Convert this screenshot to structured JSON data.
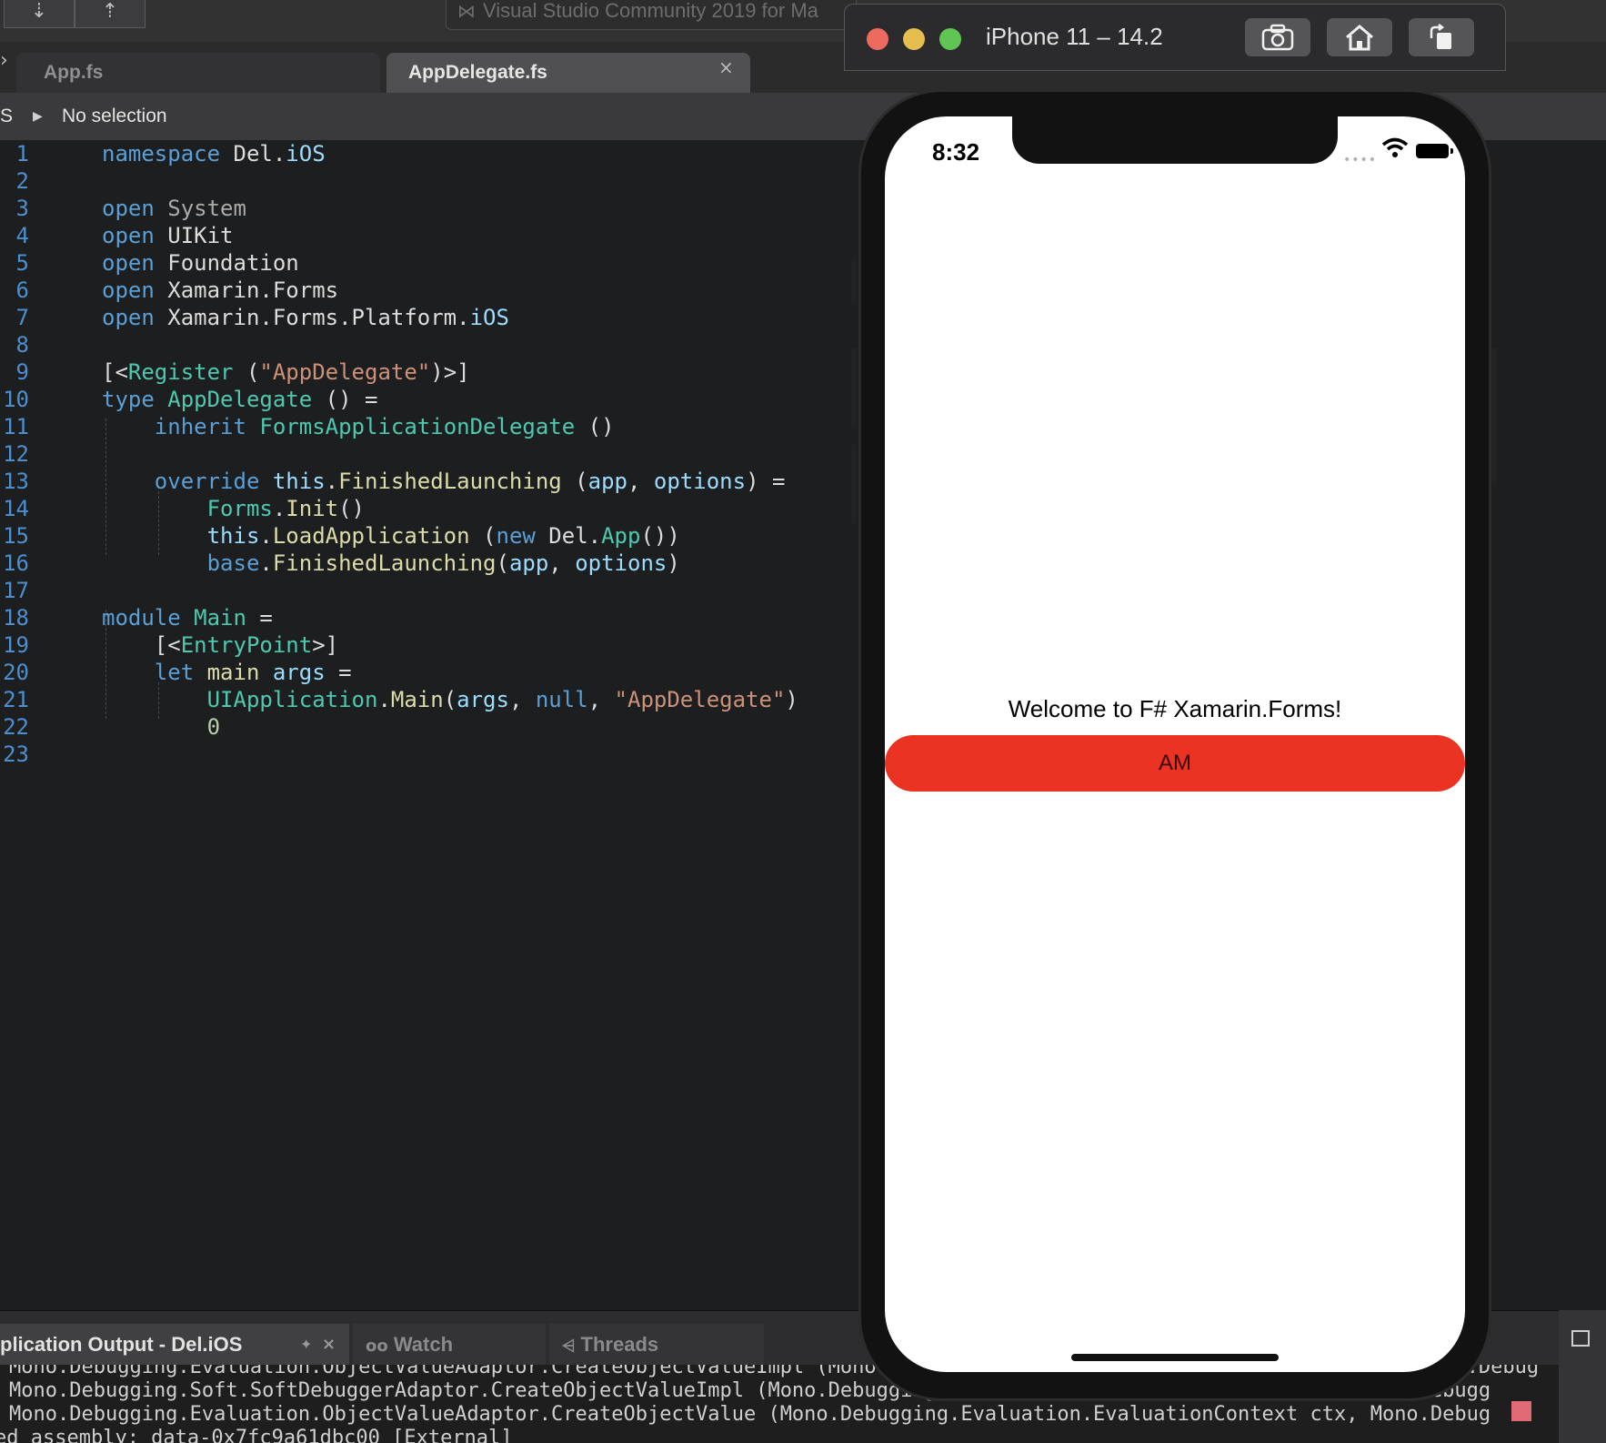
{
  "toolbar": {
    "app_title": "Visual Studio Community 2019 for Ma",
    "step_into_icon": "⇣",
    "step_out_icon": "⇡"
  },
  "tabs": [
    {
      "label": "App.fs",
      "active": false
    },
    {
      "label": "AppDelegate.fs",
      "active": true
    }
  ],
  "tab_close": "×",
  "breadcrumb": {
    "prefix": "S",
    "arrow": "▶",
    "text": "No selection"
  },
  "editor": {
    "line_numbers": [
      "1",
      "2",
      "3",
      "4",
      "5",
      "6",
      "7",
      "8",
      "9",
      "10",
      "11",
      "12",
      "13",
      "14",
      "15",
      "16",
      "17",
      "18",
      "19",
      "20",
      "21",
      "22",
      "23"
    ]
  },
  "simulator": {
    "title": "iPhone 11 – 14.2",
    "screenshot_icon": "camera-icon",
    "home_icon": "home-icon",
    "rotate_icon": "rotate-icon",
    "traffic_colors": [
      "#ed6a5e",
      "#e6be4f",
      "#61c554"
    ]
  },
  "phone": {
    "time": "8:32",
    "welcome_text": "Welcome to F# Xamarin.Forms!",
    "button_label": "AM",
    "button_color": "#ea3323"
  },
  "bottom_pad": {
    "output_tab": "plication Output - Del.iOS",
    "watch_tab": "Watch",
    "threads_tab": "Threads",
    "output_lines": [
      "Mono.Debugging.Evaluation.ObjectValueAdaptor.CreateObjectValueImpl (Mono.Debugging.Evaluation.EvaluationContext ctx, Mono.Debug",
      "Mono.Debugging.Soft.SoftDebuggerAdaptor.CreateObjectValueImpl (Mono.Debugging.Evaluation.EvaluationContext ctx, Mono.Debugg",
      "Mono.Debugging.Evaluation.ObjectValueAdaptor.CreateObjectValue (Mono.Debugging.Evaluation.EvaluationContext ctx, Mono.Debug",
      "ed assembly: data-0x7fc9a61dbc00 [External]"
    ]
  }
}
